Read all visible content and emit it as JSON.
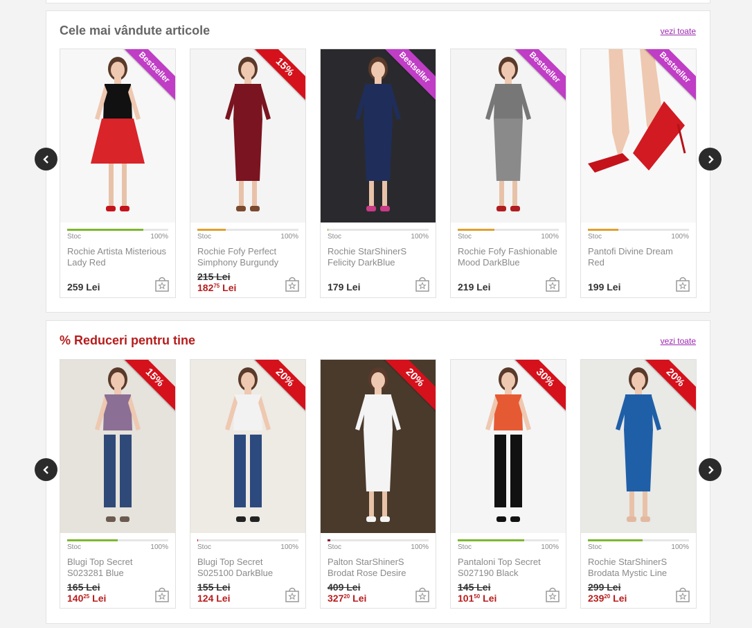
{
  "sections": [
    {
      "title": "Cele mai vândute articole",
      "see_all": "vezi toate",
      "products": [
        {
          "ribbon": "Bestseller",
          "ribbon_type": "pink",
          "stock_label": "Stoc",
          "stock_pct": "100%",
          "stock_level": 0.75,
          "stock_color": "#7cb82f",
          "name": "Rochie Artista Misterious Lady Red",
          "price": "259 Lei"
        },
        {
          "ribbon": "15%",
          "ribbon_type": "red",
          "stock_label": "Stoc",
          "stock_pct": "100%",
          "stock_level": 0.28,
          "stock_color": "#e0a030",
          "name": "Rochie Fofy Perfect Simphony Burgundy",
          "old_price": "215 Lei",
          "new_price_int": "182",
          "new_price_dec": "75",
          "new_price_cur": "Lei"
        },
        {
          "ribbon": "Bestseller",
          "ribbon_type": "pink",
          "stock_label": "Stoc",
          "stock_pct": "100%",
          "stock_level": 0.0,
          "stock_color": "#7cb82f",
          "name": "Rochie StarShinerS Felicity DarkBlue",
          "price": "179 Lei"
        },
        {
          "ribbon": "Bestseller",
          "ribbon_type": "pink",
          "stock_label": "Stoc",
          "stock_pct": "100%",
          "stock_level": 0.36,
          "stock_color": "#e0a030",
          "name": "Rochie Fofy Fashionable Mood DarkBlue",
          "price": "219 Lei"
        },
        {
          "ribbon": "Bestseller",
          "ribbon_type": "pink",
          "stock_label": "Stoc",
          "stock_pct": "100%",
          "stock_level": 0.3,
          "stock_color": "#e0a030",
          "name": "Pantofi Divine Dream Red",
          "price": "199 Lei"
        }
      ]
    },
    {
      "title": "% Reduceri pentru tine",
      "see_all": "vezi toate",
      "products": [
        {
          "ribbon": "15%",
          "ribbon_type": "red",
          "stock_label": "Stoc",
          "stock_pct": "100%",
          "stock_level": 0.5,
          "stock_color": "#7cb82f",
          "name": "Blugi Top Secret S023281 Blue",
          "old_price": "165 Lei",
          "new_price_int": "140",
          "new_price_dec": "25",
          "new_price_cur": "Lei"
        },
        {
          "ribbon": "20%",
          "ribbon_type": "red",
          "stock_label": "Stoc",
          "stock_pct": "100%",
          "stock_level": 0.01,
          "stock_color": "#d5111c",
          "name": "Blugi Top Secret S025100 DarkBlue",
          "old_price": "155 Lei",
          "new_price_int": "124",
          "new_price_dec": "",
          "new_price_cur": "Lei"
        },
        {
          "ribbon": "20%",
          "ribbon_type": "red",
          "stock_label": "Stoc",
          "stock_pct": "100%",
          "stock_level": 0.03,
          "stock_color": "#8b1b3a",
          "name": "Palton StarShinerS Brodat Rose Desire",
          "old_price": "409 Lei",
          "new_price_int": "327",
          "new_price_dec": "20",
          "new_price_cur": "Lei"
        },
        {
          "ribbon": "30%",
          "ribbon_type": "red",
          "stock_label": "Stoc",
          "stock_pct": "100%",
          "stock_level": 0.66,
          "stock_color": "#7cb82f",
          "name": "Pantaloni Top Secret S027190 Black",
          "old_price": "145 Lei",
          "new_price_int": "101",
          "new_price_dec": "50",
          "new_price_cur": "Lei"
        },
        {
          "ribbon": "20%",
          "ribbon_type": "red",
          "stock_label": "Stoc",
          "stock_pct": "100%",
          "stock_level": 0.54,
          "stock_color": "#7cb82f",
          "name": "Rochie StarShinerS Brodata Mystic Line",
          "old_price": "299 Lei",
          "new_price_int": "239",
          "new_price_dec": "20",
          "new_price_cur": "Lei"
        }
      ]
    }
  ]
}
